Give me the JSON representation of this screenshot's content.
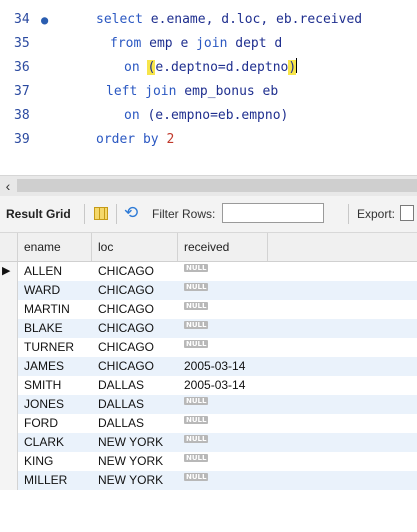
{
  "editor": {
    "lines": [
      {
        "num": "34",
        "parts": [
          {
            "t": "select ",
            "c": "kw"
          },
          {
            "t": "e.ename, d.loc, eb.received",
            "c": "plain"
          }
        ]
      },
      {
        "num": "35",
        "parts": [
          {
            "t": "from ",
            "c": "kw"
          },
          {
            "t": "emp e ",
            "c": "plain"
          },
          {
            "t": "join ",
            "c": "kw"
          },
          {
            "t": "dept d",
            "c": "plain"
          }
        ]
      },
      {
        "num": "36",
        "parts": [
          {
            "t": "on ",
            "c": "kw"
          },
          {
            "t": "(",
            "c": "hl"
          },
          {
            "t": "e.deptno=d.deptno",
            "c": "plain"
          },
          {
            "t": ")",
            "c": "hl"
          }
        ]
      },
      {
        "num": "37",
        "parts": [
          {
            "t": "left ",
            "c": "kw"
          },
          {
            "t": "join ",
            "c": "kw"
          },
          {
            "t": "emp_bonus eb",
            "c": "plain"
          }
        ]
      },
      {
        "num": "38",
        "parts": [
          {
            "t": "on ",
            "c": "kw"
          },
          {
            "t": "(e.empno=eb.empno)",
            "c": "plain"
          }
        ]
      },
      {
        "num": "39",
        "parts": [
          {
            "t": "order by ",
            "c": "kw"
          },
          {
            "t": "2",
            "c": "num"
          }
        ]
      }
    ]
  },
  "toolbar": {
    "title": "Result Grid",
    "filter_label": "Filter Rows:",
    "filter_value": "",
    "export_label": "Export:"
  },
  "grid": {
    "columns": [
      "ename",
      "loc",
      "received"
    ],
    "null_label": "NULL",
    "current_row_marker": "▶",
    "rows": [
      {
        "ename": "ALLEN",
        "loc": "CHICAGO",
        "received": null
      },
      {
        "ename": "WARD",
        "loc": "CHICAGO",
        "received": null
      },
      {
        "ename": "MARTIN",
        "loc": "CHICAGO",
        "received": null
      },
      {
        "ename": "BLAKE",
        "loc": "CHICAGO",
        "received": null
      },
      {
        "ename": "TURNER",
        "loc": "CHICAGO",
        "received": null
      },
      {
        "ename": "JAMES",
        "loc": "CHICAGO",
        "received": "2005-03-14"
      },
      {
        "ename": "SMITH",
        "loc": "DALLAS",
        "received": "2005-03-14"
      },
      {
        "ename": "JONES",
        "loc": "DALLAS",
        "received": null
      },
      {
        "ename": "FORD",
        "loc": "DALLAS",
        "received": null
      },
      {
        "ename": "CLARK",
        "loc": "NEW YORK",
        "received": null
      },
      {
        "ename": "KING",
        "loc": "NEW YORK",
        "received": null
      },
      {
        "ename": "MILLER",
        "loc": "NEW YORK",
        "received": null
      }
    ]
  }
}
